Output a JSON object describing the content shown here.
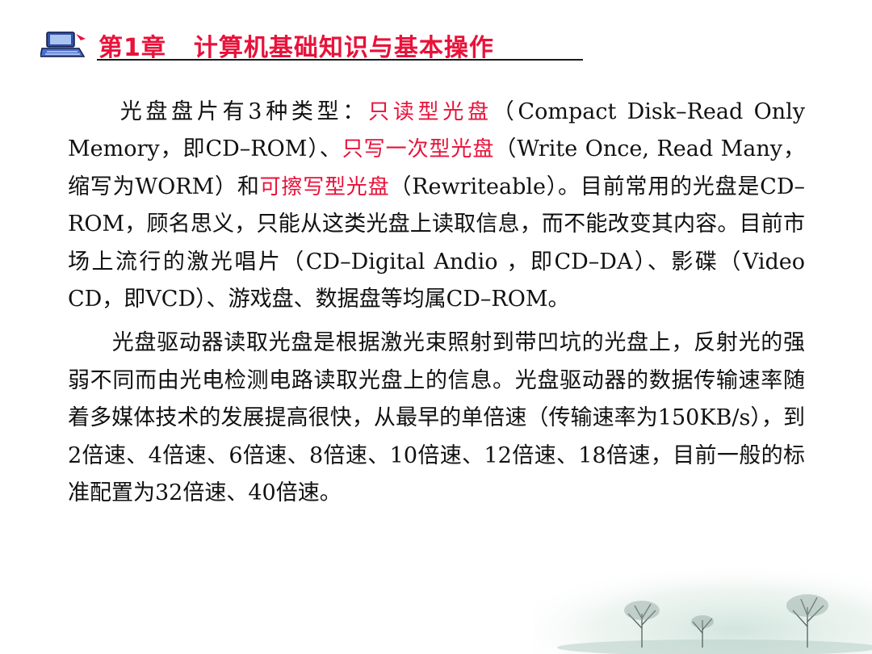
{
  "header": {
    "chapter": "第1章",
    "title": "计算机基础知识与基本操作",
    "logo_icon": "computer-icon"
  },
  "paragraph1": {
    "s1": "光盘盘片有3种类型：",
    "red1": "只读型光盘",
    "s2": "（Compact Disk–Read Only Memory，即CD–ROM）、",
    "red2": "只写一次型光盘",
    "s3": "（Write Once, Read Many，缩写为WORM）和",
    "red3": "可擦写型光盘",
    "s4": "（Rewriteable）。目前常用的光盘是CD–ROM，顾名思义，只能从这类光盘上读取信息，而不能改变其内容。目前市场上流行的激光唱片（CD–Digital Andio ，即CD–DA）、影碟（Video CD，即VCD）、游戏盘、数据盘等均属CD–ROM。"
  },
  "paragraph2": {
    "text": "光盘驱动器读取光盘是根据激光束照射到带凹坑的光盘上，反射光的强弱不同而由光电检测电路读取光盘上的信息。光盘驱动器的数据传输速率随着多媒体技术的发展提高很快，从最早的单倍速（传输速率为150KB/s），到2倍速、4倍速、6倍速、8倍速、10倍速、12倍速、18倍速，目前一般的标准配置为32倍速、40倍速。"
  },
  "colors": {
    "accent_red": "#e8123a",
    "text": "#111111",
    "background": "#ffffff"
  }
}
